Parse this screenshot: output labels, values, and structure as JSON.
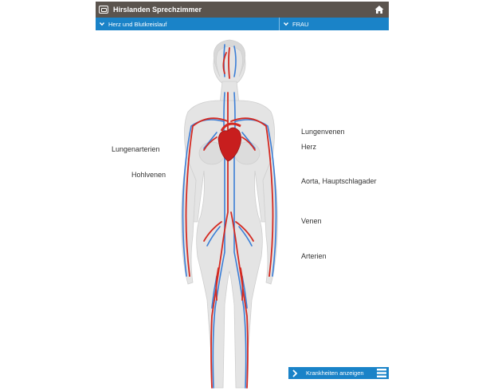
{
  "app": {
    "title": "Hirslanden Sprechzimmer"
  },
  "nav": {
    "topic": "Herz und Blutkreislauf",
    "gender": "FRAU"
  },
  "labels": {
    "lungenarterien": "Lungenarterien",
    "hohlvenen": "Hohlvenen",
    "lungenvenen": "Lungenvenen",
    "herz": "Herz",
    "aorta": "Aorta, Hauptschlagader",
    "venen": "Venen",
    "arterien": "Arterien"
  },
  "action": {
    "show_diseases": "Krankheiten anzeigen"
  },
  "colors": {
    "title_bar": "#5b544e",
    "accent_blue": "#1a83c8",
    "artery_red": "#d42a22",
    "vein_blue": "#3b7ed6",
    "body_gray": "#e4e4e4"
  },
  "icons": [
    "app-window-icon",
    "home-icon",
    "chevron-down-icon",
    "chevron-right-icon",
    "menu-icon"
  ]
}
